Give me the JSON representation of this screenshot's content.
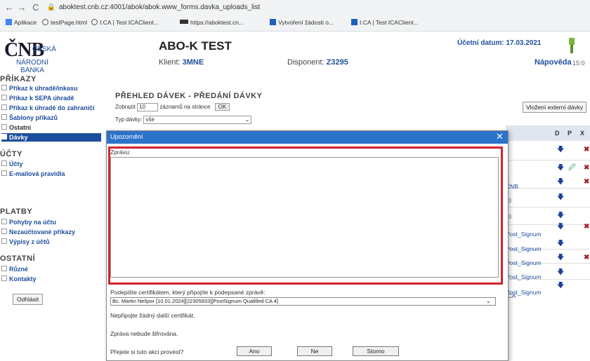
{
  "browser": {
    "url": "aboktest.cnb.cz:4001/abok/abok.www_forms.davka_uploads_list",
    "bookmarks": [
      "Aplikace",
      "testPage.html",
      "I.CA | Test ICAClient...",
      "https://aboktest.cn...",
      "Vytvoření žádosti o...",
      "I.CA | Test ICAClient..."
    ]
  },
  "header": {
    "logo_main": "ČNB",
    "logo_ceska": "ČESKÁ",
    "logo_narodni": "NÁRODNÍ BANKA",
    "app_title": "ABO-K TEST",
    "klient_label": "Klient:",
    "klient_value": "3MNE",
    "disponent_label": "Disponent:",
    "disponent_value": "Z3295",
    "ucetni_datum": "Účetní datum: 17.03.2021",
    "napoveda": "Nápověda",
    "time": "15:0"
  },
  "sidebar": {
    "sections": [
      {
        "title": "PŘÍKAZY",
        "items": [
          "Příkaz k úhradě/inkasu",
          "Příkaz k SEPA úhradě",
          "Příkaz k úhradě do zahraničí",
          "Šablony příkazů",
          "Ostatní",
          "Dávky"
        ]
      },
      {
        "title": "ÚČTY",
        "items": [
          "Účty",
          "E-mailová pravidla"
        ]
      },
      {
        "title": "PLATBY",
        "items": [
          "Pohyby na účtu",
          "Nezaúčtované příkazy",
          "Výpisy z účtů"
        ]
      },
      {
        "title": "OSTATNÍ",
        "items": [
          "Různé",
          "Kontakty"
        ]
      }
    ],
    "logout": "Odhlásit"
  },
  "content": {
    "title": "PŘEHLED DÁVEK - PŘEDÁNÍ DÁVKY",
    "zobrazit": "Zobrazit",
    "zobrazit_value": "10",
    "zaznamu": "záznamů na stránce",
    "ok": "OK",
    "typ_label": "Typ dávky:",
    "typ_value": "vše",
    "vlozeni": "Vložení externí dávky",
    "columns": [
      "D",
      "P",
      "X"
    ],
    "rows": [
      "",
      "ČNB",
      "EI",
      "EI",
      "Post_Signum",
      "Post_Signum",
      "Post_Signum",
      "Post_Signum",
      "Post_Signum",
      "ICA"
    ]
  },
  "dialog": {
    "title": "Upozornění",
    "zpravu_label": "Zprávu:",
    "message": "",
    "podepiste": "Podepište certifikátem, který připojíte k podepsané zprávě:",
    "cert_value": "Bc. Martin Nešpor [10.01.2024][22305933][PostSignum Qualified CA 4]",
    "nepripojte": "Nepřipojte žádný další certifikát.",
    "nebude": "Zpráva nebude šifrována.",
    "prejete": "Přejete si tuto akci provést?",
    "ano": "Ano",
    "ne": "Ne",
    "storno": "Storno"
  },
  "colors": {
    "accent": "#1d4f9c",
    "dialog_bar": "#2b72c9",
    "highlight": "#d0262f"
  }
}
